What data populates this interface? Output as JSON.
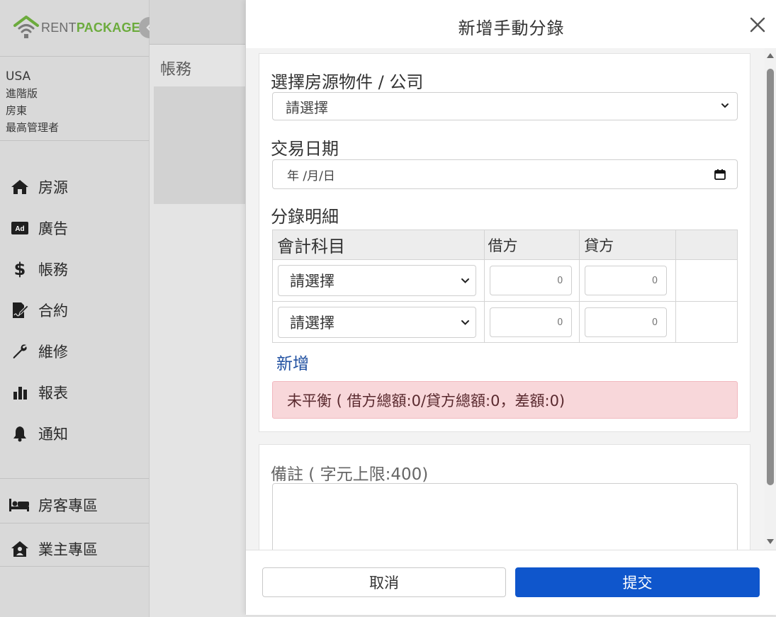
{
  "brand": {
    "logo_text_a": "RENT",
    "logo_text_b": "PACKAGE",
    "color_green": "#6cab3d"
  },
  "user": {
    "country": "USA",
    "plan": "進階版",
    "role": "房東",
    "permission": "最高管理者"
  },
  "nav": {
    "items": [
      {
        "label": "房源",
        "icon": "home-icon"
      },
      {
        "label": "廣告",
        "icon": "ad-icon"
      },
      {
        "label": "帳務",
        "icon": "dollar-icon"
      },
      {
        "label": "合約",
        "icon": "contract-icon"
      },
      {
        "label": "維修",
        "icon": "wrench-icon"
      },
      {
        "label": "報表",
        "icon": "bar-chart-icon"
      },
      {
        "label": "通知",
        "icon": "bell-icon"
      }
    ],
    "tenant_zone": "房客專區",
    "owner_zone": "業主專區"
  },
  "page": {
    "title": "帳務"
  },
  "modal": {
    "title": "新增手動分錄",
    "property_label": "選擇房源物件 / 公司",
    "property_value": "請選擇",
    "date_label": "交易日期",
    "date_placeholder": "年 /月/日",
    "entries_label": "分錄明細",
    "table": {
      "col_account": "會計科目",
      "col_debit": "借方",
      "col_credit": "貸方",
      "rows": [
        {
          "account": "請選擇",
          "debit": "0",
          "credit": "0"
        },
        {
          "account": "請選擇",
          "debit": "0",
          "credit": "0"
        }
      ]
    },
    "add_link": "新增",
    "alert_text": "未平衡 ( 借方總額:0/貸方總額:0，差額:0)",
    "remark_label": "備註 ( 字元上限:400)",
    "cancel_label": "取消",
    "submit_label": "提交",
    "colors": {
      "submit": "#0f56cc",
      "alert_bg": "#f8d7da"
    }
  }
}
